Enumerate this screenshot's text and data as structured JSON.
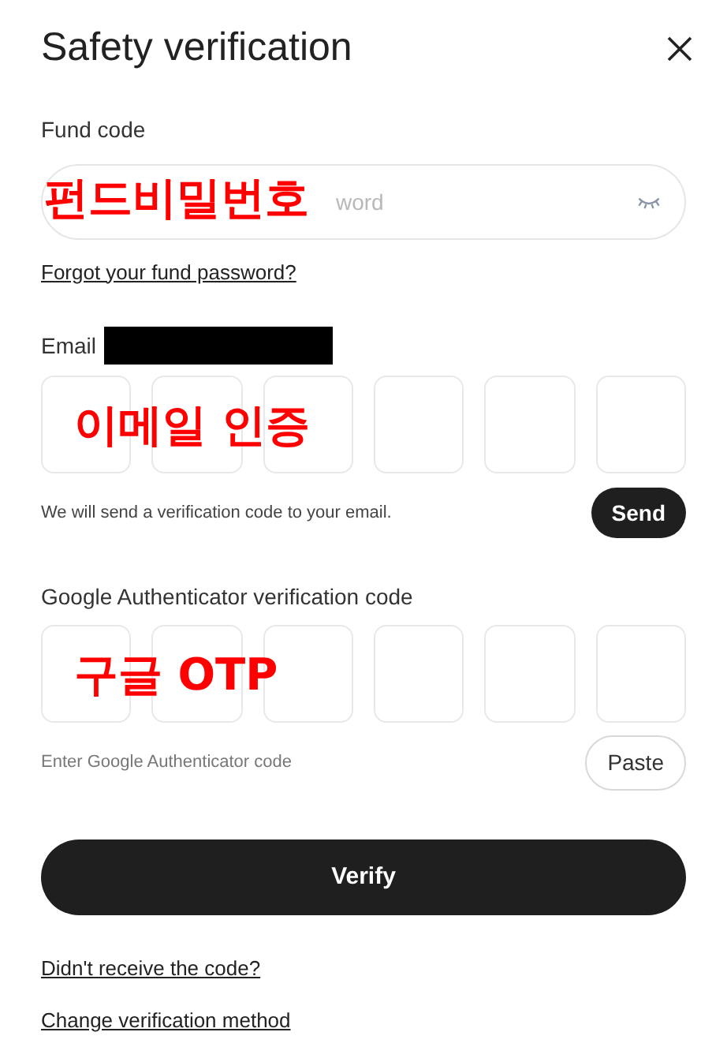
{
  "title": "Safety verification",
  "fund_code": {
    "label": "Fund code",
    "placeholder": "word",
    "annotation": "펀드비밀번호",
    "forgot_link": "Forgot your fund password?"
  },
  "email": {
    "label": "Email",
    "redacted": true,
    "annotation": "이메일 인증",
    "hint": "We will send a verification code to your email.",
    "button": "Send"
  },
  "google": {
    "label": "Google Authenticator verification code",
    "annotation": "구글 OTP",
    "hint": "Enter Google Authenticator code",
    "button": "Paste"
  },
  "verify_button": "Verify",
  "links": [
    "Didn't receive the code?",
    "Change verification method"
  ]
}
